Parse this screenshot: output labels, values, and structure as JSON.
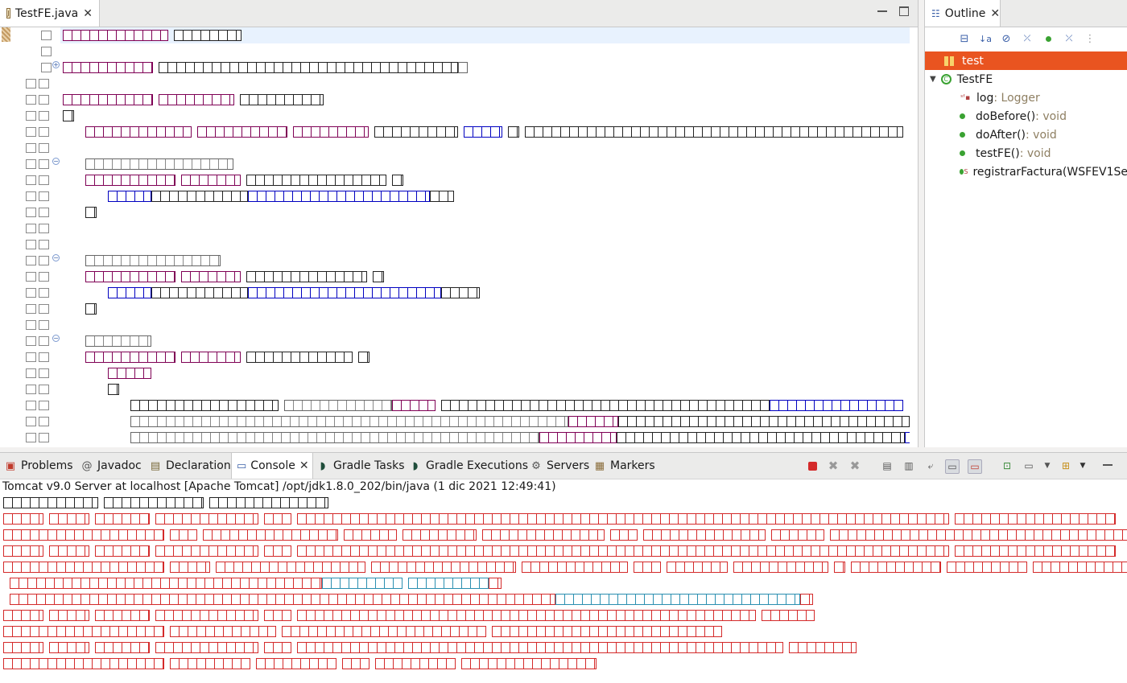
{
  "editor": {
    "tab_label": "TestFE.java"
  },
  "outline": {
    "tab_label": "Outline",
    "items": [
      {
        "label": "test",
        "type": ""
      },
      {
        "label": "TestFE",
        "type": ""
      },
      {
        "label": "log",
        "type": " : Logger"
      },
      {
        "label": "doBefore()",
        "type": " : void"
      },
      {
        "label": "doAfter()",
        "type": " : void"
      },
      {
        "label": "testFE()",
        "type": " : void"
      },
      {
        "label": "registrarFactura(WSFEV1Se",
        "type": ""
      }
    ]
  },
  "bottom_tabs": [
    {
      "label": "Problems",
      "icon": "problems-icon"
    },
    {
      "label": "Javadoc",
      "icon": "javadoc-icon"
    },
    {
      "label": "Declaration",
      "icon": "declaration-icon"
    },
    {
      "label": "Console",
      "icon": "console-icon"
    },
    {
      "label": "Gradle Tasks",
      "icon": "gradle-icon"
    },
    {
      "label": "Gradle Executions",
      "icon": "gradle-icon"
    },
    {
      "label": "Servers",
      "icon": "servers-icon"
    },
    {
      "label": "Markers",
      "icon": "markers-icon"
    }
  ],
  "console": {
    "title": "Tomcat v9.0 Server at localhost [Apache Tomcat] /opt/jdk1.8.0_202/bin/java  (1 dic 2021 12:49:41)"
  },
  "colors": {
    "keyword": "#7f0055",
    "field": "#0000c0",
    "error": "#d42a2a",
    "link": "#2a8fb0",
    "selection": "#e95420"
  }
}
